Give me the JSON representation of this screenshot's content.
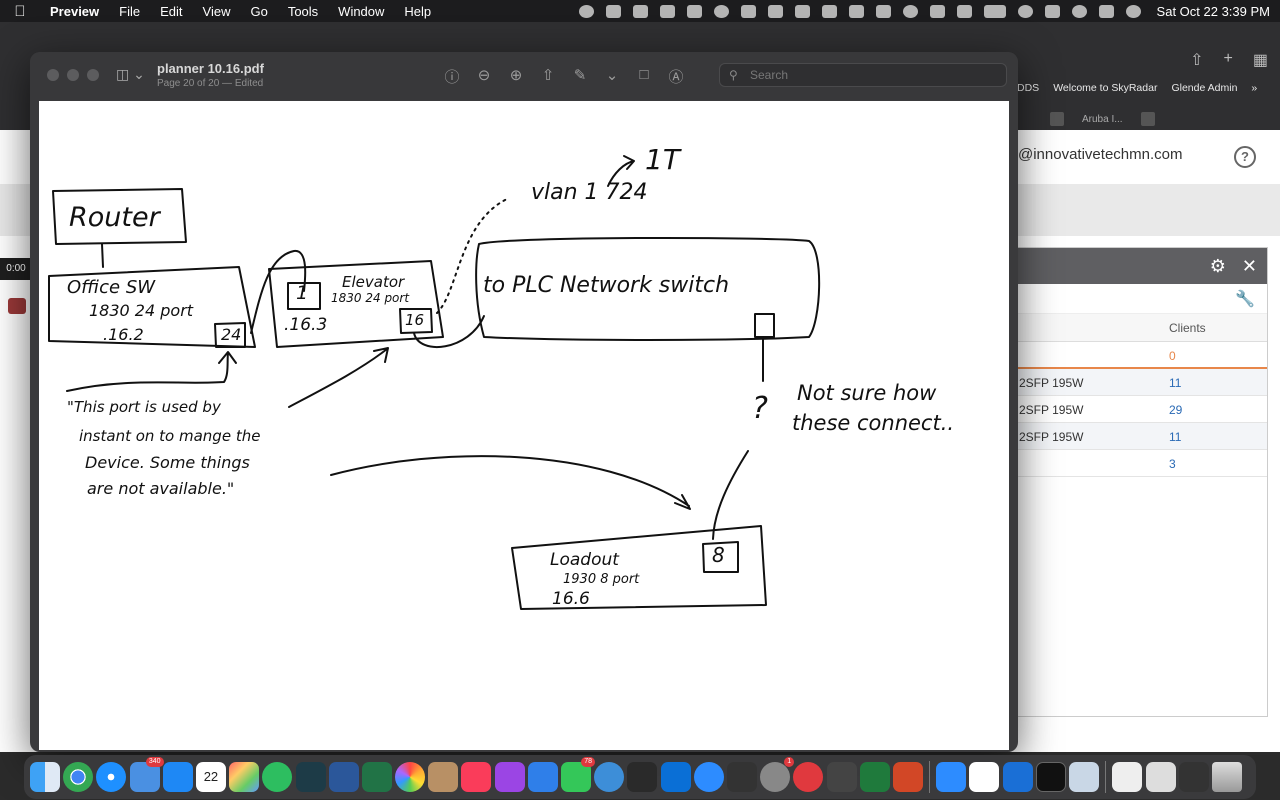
{
  "menubar": {
    "app_name": "Preview",
    "menus": [
      "File",
      "Edit",
      "View",
      "Go",
      "Tools",
      "Window",
      "Help"
    ],
    "clock": "Sat Oct 22  3:39 PM"
  },
  "browser": {
    "bookmarks": [
      "ADDS",
      "Welcome to SkyRadar",
      "Glende Admin"
    ],
    "tab_label": "Aruba I...",
    "email": "@innovativetechmn.com",
    "help_icon": "?",
    "time_overlay": "0:00",
    "panel": {
      "column_header": "Clients",
      "rows": [
        {
          "model": "",
          "clients": "0"
        },
        {
          "model": "2SFP 195W",
          "clients": "11"
        },
        {
          "model": "2SFP 195W",
          "clients": "29"
        },
        {
          "model": "2SFP 195W",
          "clients": "11"
        },
        {
          "model": "",
          "clients": "3"
        }
      ]
    }
  },
  "preview": {
    "title": "planner 10.16.pdf",
    "subtitle": "Page 20 of 20 — Edited",
    "search_placeholder": "Search"
  },
  "drawing": {
    "router": "Router",
    "office_sw": [
      "Office SW",
      "1830 24 port",
      ".16.2"
    ],
    "office_port": "24",
    "elevator": [
      "Elevator",
      "1830 24 port",
      ".16.3"
    ],
    "elevator_port1": "1",
    "elevator_port16": "16",
    "vlan_note": "vlan 1 724",
    "vlan_1t": "1T",
    "plc_switch": "to PLC Network switch",
    "question": "?",
    "not_sure": [
      "Not sure how",
      "these connect.."
    ],
    "quote": [
      "\"This port is used by",
      "instant on to mange the",
      "Device. Some things",
      "are not available.\""
    ],
    "loadout": [
      "Loadout",
      "1930 8 port",
      "16.6"
    ],
    "loadout_port": "8"
  },
  "dock": {
    "apps": [
      "finder",
      "chrome",
      "safari",
      "mail",
      "app-store",
      "calendar",
      "launchpad",
      "evernote",
      "terminal-alt",
      "word",
      "excel",
      "photos",
      "contacts",
      "music",
      "podcasts",
      "keynote",
      "messages",
      "settings-alt",
      "notes",
      "box",
      "zoom",
      "rm",
      "system-preferences",
      "remote",
      "calculator",
      "phone",
      "powerpoint",
      "zoom-app",
      "slack",
      "network",
      "terminal",
      "preview-doc",
      "downloads",
      "trash"
    ],
    "calendar_day": "22",
    "calendar_month": "OCT",
    "mail_badge": "340",
    "messages_badge": "78",
    "system_badge": "1"
  }
}
